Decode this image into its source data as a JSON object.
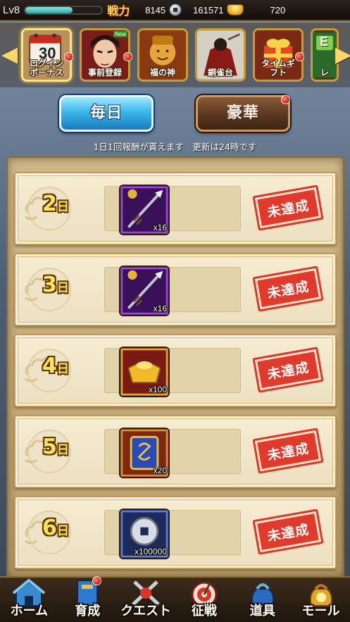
{
  "status_bar": {
    "level": "Lv8",
    "exp_fraction": 0.62,
    "power_label": "戦力",
    "power_value": "8145",
    "coins": "161571",
    "gold": "720"
  },
  "events": [
    {
      "id": "login-bonus",
      "label": "ログイン\nボーナス",
      "label_l1": "ログイン",
      "label_l2": "ボーナス",
      "calendar_number": "30",
      "badge": true,
      "new": false,
      "selected": true
    },
    {
      "id": "pre-registration",
      "label_l1": "事前登録",
      "badge": true,
      "new": true
    },
    {
      "id": "fortune-god",
      "label_l1": "福の神",
      "badge": false,
      "new": false
    },
    {
      "id": "bronze-sparrow",
      "label_l1": "銅雀台",
      "badge": false,
      "new": false
    },
    {
      "id": "time-gift",
      "label_l1": "タイムギ",
      "label_l2": "フト",
      "badge": true,
      "new": false
    },
    {
      "id": "partial",
      "label_l1": "レ",
      "label_top": "E",
      "badge": false,
      "new": false
    }
  ],
  "tabs": {
    "daily": "毎日",
    "deluxe": "豪華",
    "deluxe_badge": true
  },
  "note": "1日1回報酬が貰えます　更新は24時です",
  "rewards": [
    {
      "day": "2",
      "unit": "日",
      "item": "spear",
      "qty": "x16",
      "status": "未達成"
    },
    {
      "day": "3",
      "unit": "日",
      "item": "spear",
      "qty": "x16",
      "status": "未達成"
    },
    {
      "day": "4",
      "unit": "日",
      "item": "gold-ingot",
      "qty": "x100",
      "status": "未達成"
    },
    {
      "day": "5",
      "unit": "日",
      "item": "scroll-card",
      "qty": "x20",
      "status": "未達成"
    },
    {
      "day": "6",
      "unit": "日",
      "item": "silver-coin",
      "qty": "x100000",
      "status": "未達成"
    }
  ],
  "nav": [
    {
      "id": "home",
      "label": "ホーム",
      "icon": "castle-icon",
      "badge": false
    },
    {
      "id": "training",
      "label": "育成",
      "icon": "book-icon",
      "badge": true
    },
    {
      "id": "quest",
      "label": "クエスト",
      "icon": "crossed-swords-icon",
      "badge": false
    },
    {
      "id": "campaign",
      "label": "征戦",
      "icon": "target-icon",
      "badge": false
    },
    {
      "id": "items",
      "label": "道具",
      "icon": "bag-icon",
      "badge": false
    },
    {
      "id": "mall",
      "label": "モール",
      "icon": "coin-bag-icon",
      "badge": false
    }
  ],
  "colors": {
    "accent_gold": "#ffd74a",
    "stamp_red": "#e13a2c",
    "daily_tab_blue": "#3cb7ea",
    "deluxe_tab_brown": "#5a3620"
  }
}
